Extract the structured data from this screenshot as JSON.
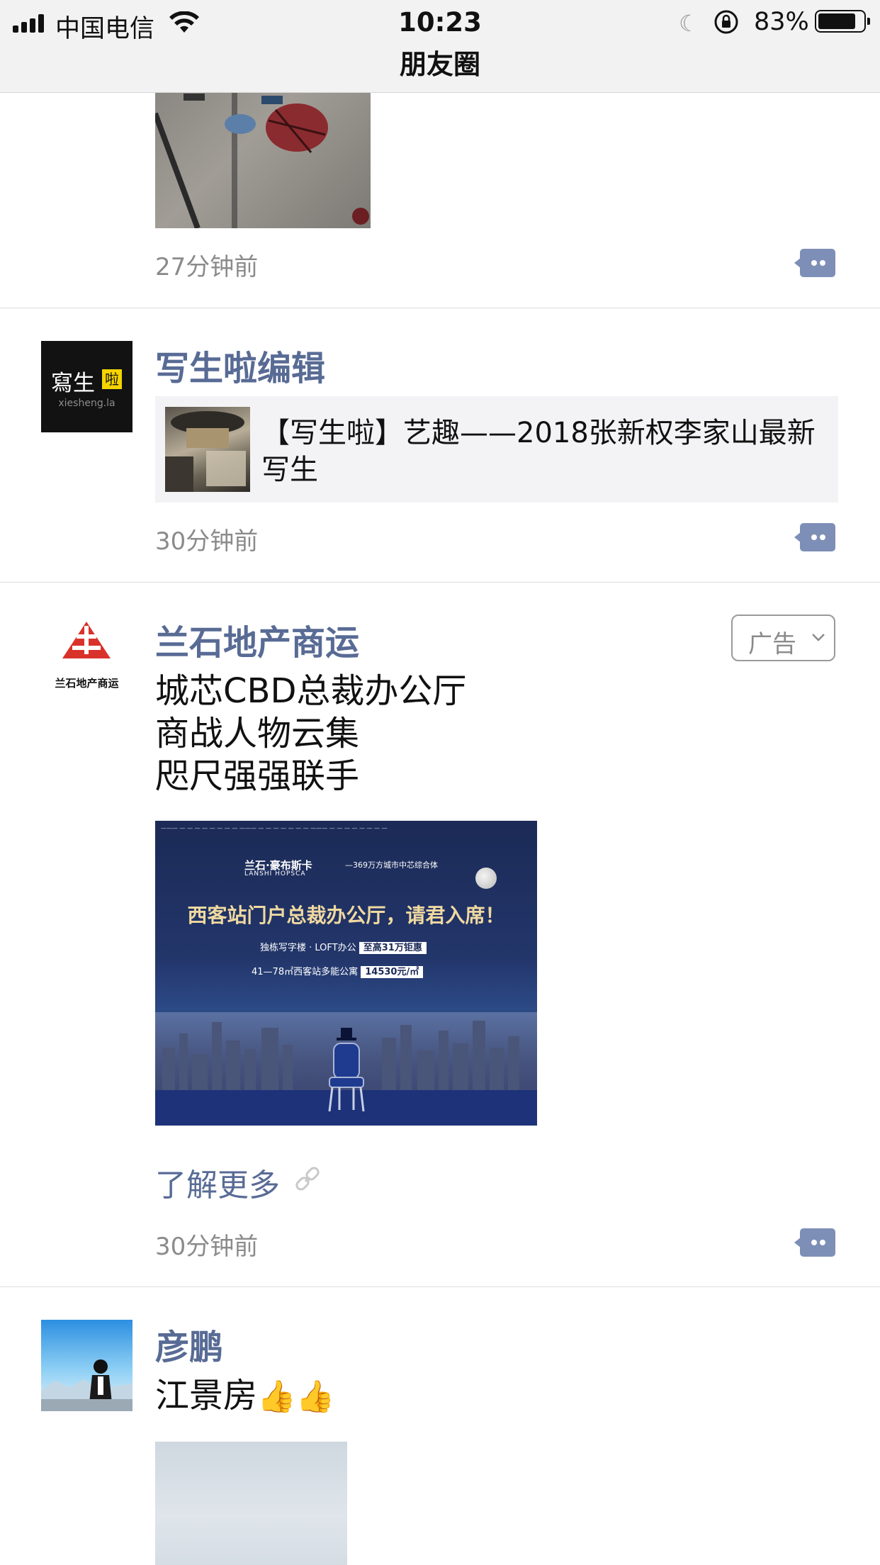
{
  "status_bar": {
    "carrier": "中国电信",
    "time": "10:23",
    "battery_percent": "83%",
    "battery_level": 0.83
  },
  "nav": {
    "title": "朋友圈"
  },
  "posts": [
    {
      "timestamp": "27分钟前"
    },
    {
      "author": "写生啦编辑",
      "avatar_text": "寫生",
      "avatar_badge": "啦",
      "avatar_sub": "xiesheng.la",
      "link_title": "【写生啦】艺趣——2018张新权李家山最新写生",
      "timestamp": "30分钟前"
    },
    {
      "author": "兰石地产商运",
      "avatar_text": "兰石地产商运",
      "ad_label": "广告",
      "body_lines": [
        "城芯CBD总裁办公厅",
        "商战人物云集",
        "咫尺强强联手"
      ],
      "ad_image": {
        "brand": "兰石·豪布斯卡",
        "brand_en": "LANSHI HOPSCA",
        "brand_sub": "—369万方城市中芯综合体",
        "headline": "西客站门户总裁办公厅，请君入席！",
        "line1_left": "独栋写字楼 · LOFT办公",
        "line1_hl": "至高31万钜惠",
        "line2_left": "41—78㎡西客站多能公寓",
        "line2_hl": "14530元/㎡"
      },
      "learn_more": "了解更多",
      "timestamp": "30分钟前"
    },
    {
      "author": "彦鹏",
      "body": "江景房",
      "emoji": "👍👍"
    }
  ]
}
